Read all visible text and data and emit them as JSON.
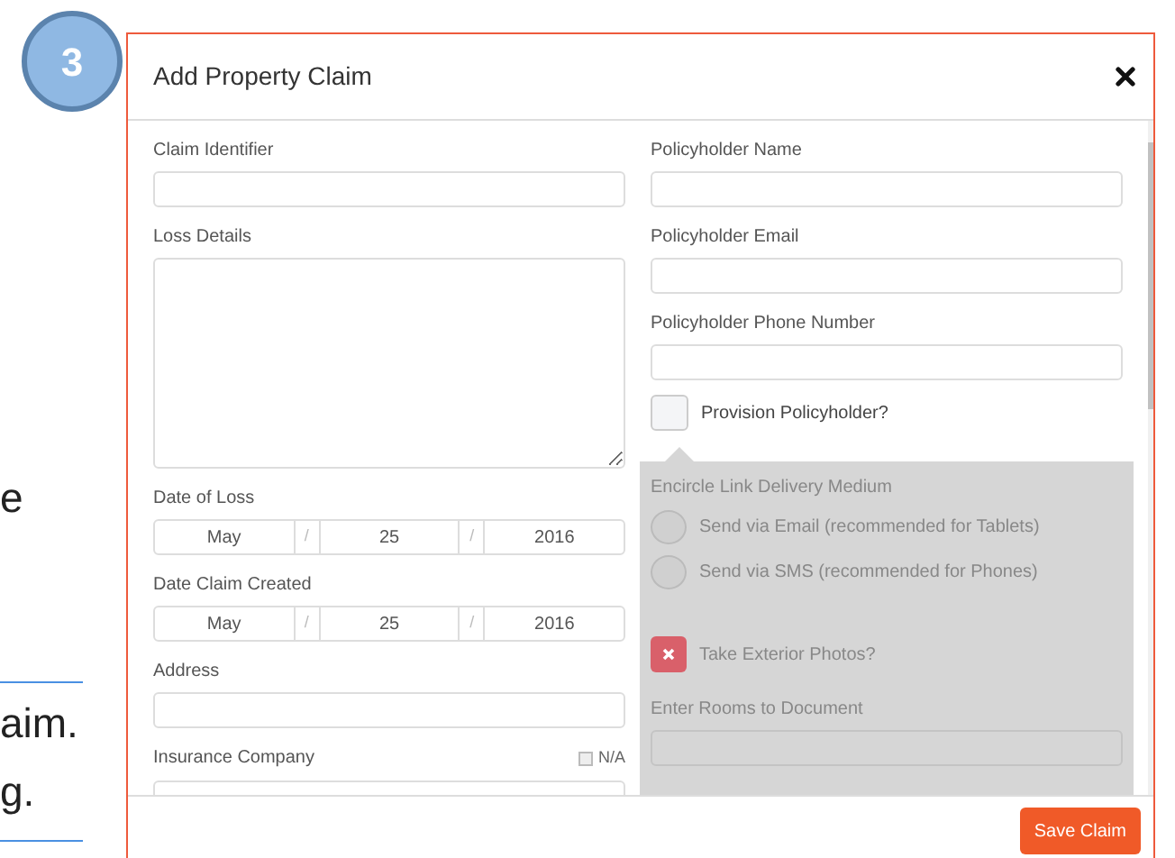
{
  "step_badge": "3",
  "background_text": [
    "e",
    "aim.",
    "g."
  ],
  "dialog": {
    "title": "Add Property Claim",
    "left_fields": [
      {
        "kind": "text",
        "label": "Claim Identifier"
      },
      {
        "kind": "textarea",
        "label": "Loss Details"
      },
      {
        "kind": "date",
        "label": "Date of Loss",
        "month": "May",
        "day": "25",
        "year": "2016",
        "separator": "/"
      },
      {
        "kind": "date",
        "label": "Date Claim Created",
        "month": "May",
        "day": "25",
        "year": "2016",
        "separator": "/"
      },
      {
        "kind": "text",
        "label": "Address"
      },
      {
        "kind": "text",
        "label": "Insurance Company",
        "option": {
          "label": "N/A",
          "checked": false
        }
      }
    ],
    "right_fields": [
      {
        "kind": "text",
        "label": "Policyholder Name"
      },
      {
        "kind": "text",
        "label": "Policyholder Email"
      },
      {
        "kind": "text",
        "label": "Policyholder Phone Number"
      },
      {
        "kind": "checkbox",
        "label": "Provision Policyholder?",
        "checked": false
      }
    ],
    "panel": {
      "disabled": true,
      "heading": "Encircle Link Delivery Medium",
      "options": [
        {
          "label": "Send via Email (recommended for Tablets)",
          "selected": false
        },
        {
          "label": "Send via SMS (recommended for Phones)",
          "selected": false
        }
      ],
      "toggle": {
        "label": "Take Exterior Photos?",
        "checked": false
      },
      "rooms_label": "Enter Rooms to Document"
    },
    "save_button": "Save Claim"
  }
}
